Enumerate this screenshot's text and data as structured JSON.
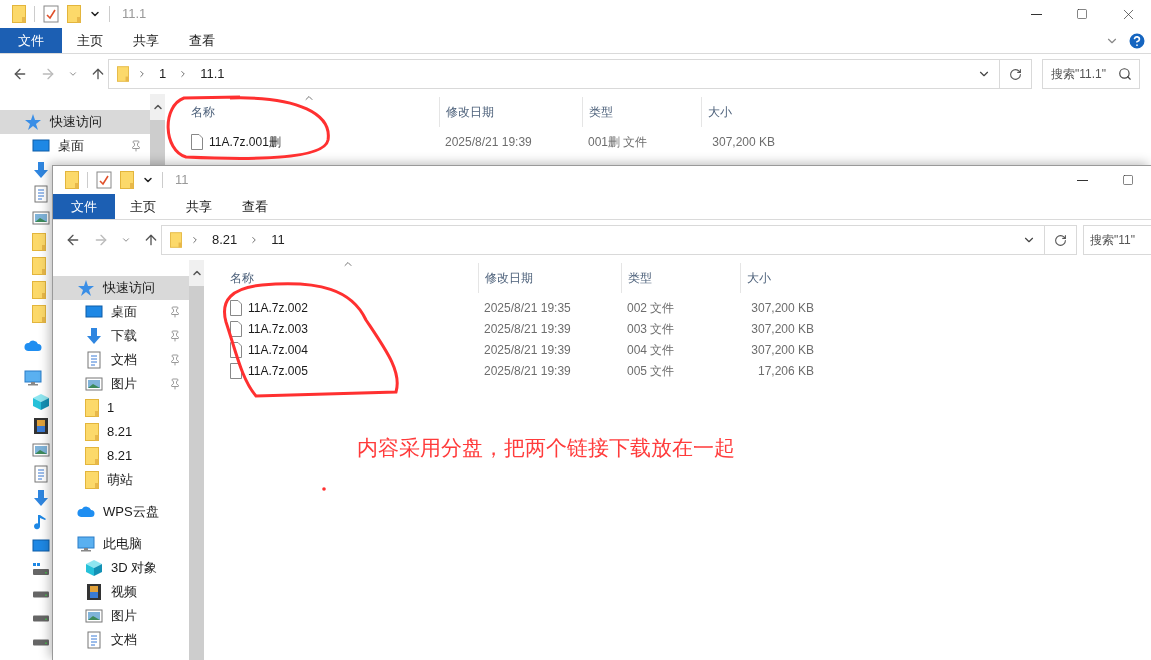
{
  "back_window": {
    "title": "11.1",
    "ribbon_tabs": [
      {
        "label": "文件",
        "kind": "menu"
      },
      {
        "label": "主页",
        "kind": "tab"
      },
      {
        "label": "共享",
        "kind": "tab"
      },
      {
        "label": "查看",
        "kind": "tab"
      }
    ],
    "breadcrumb": [
      "1",
      "11.1"
    ],
    "search": {
      "placeholder": "搜索\"11.1\""
    },
    "sidebar": [
      {
        "label": "快速访问",
        "kind": "star",
        "selected": true,
        "children": [
          {
            "label": "桌面",
            "kind": "desktop",
            "pinned": true
          },
          {
            "kind": "download"
          },
          {
            "kind": "document"
          },
          {
            "kind": "picture"
          },
          {
            "kind": "folder"
          },
          {
            "kind": "folder"
          },
          {
            "kind": "folder"
          },
          {
            "kind": "folder"
          }
        ]
      },
      {
        "kind": "cloud",
        "selected": false
      },
      {
        "kind": "pc",
        "selected": false,
        "children": [
          {
            "kind": "cube"
          },
          {
            "kind": "video"
          },
          {
            "kind": "picture"
          },
          {
            "kind": "document"
          },
          {
            "kind": "download"
          },
          {
            "kind": "music"
          },
          {
            "kind": "desktop"
          },
          {
            "kind": "drive-win"
          },
          {
            "kind": "drive"
          },
          {
            "kind": "drive"
          },
          {
            "kind": "drive"
          }
        ]
      }
    ],
    "columns": [
      "名称",
      "修改日期",
      "类型",
      "大小"
    ],
    "rows": [
      {
        "name": "11A.7z.001删",
        "date": "2025/8/21 19:39",
        "type": "001删 文件",
        "size": "307,200 KB"
      }
    ]
  },
  "front_window": {
    "title": "11",
    "ribbon_tabs": [
      {
        "label": "文件",
        "kind": "menu"
      },
      {
        "label": "主页",
        "kind": "tab"
      },
      {
        "label": "共享",
        "kind": "tab"
      },
      {
        "label": "查看",
        "kind": "tab"
      }
    ],
    "breadcrumb": [
      "8.21",
      "11"
    ],
    "search": {
      "placeholder": "搜索\"11\""
    },
    "sidebar": [
      {
        "label": "快速访问",
        "kind": "star",
        "selected": true,
        "children": [
          {
            "label": "桌面",
            "kind": "desktop",
            "pinned": true
          },
          {
            "label": "下载",
            "kind": "download",
            "pinned": true
          },
          {
            "label": "文档",
            "kind": "document",
            "pinned": true
          },
          {
            "label": "图片",
            "kind": "picture",
            "pinned": true
          },
          {
            "label": "1",
            "kind": "folder",
            "pinned": false
          },
          {
            "label": "8.21",
            "kind": "folder",
            "pinned": false
          },
          {
            "label": "8.21",
            "kind": "folder",
            "pinned": false
          },
          {
            "label": "萌站",
            "kind": "folder",
            "pinned": false
          }
        ]
      },
      {
        "label": "WPS云盘",
        "kind": "cloud",
        "selected": false
      },
      {
        "label": "此电脑",
        "kind": "pc",
        "selected": false,
        "children": [
          {
            "label": "3D 对象",
            "kind": "cube"
          },
          {
            "label": "视频",
            "kind": "video"
          },
          {
            "label": "图片",
            "kind": "picture"
          },
          {
            "label": "文档",
            "kind": "document"
          }
        ]
      }
    ],
    "columns": [
      "名称",
      "修改日期",
      "类型",
      "大小"
    ],
    "rows": [
      {
        "name": "11A.7z.002",
        "date": "2025/8/21 19:35",
        "type": "002 文件",
        "size": "307,200 KB"
      },
      {
        "name": "11A.7z.003",
        "date": "2025/8/21 19:39",
        "type": "003 文件",
        "size": "307,200 KB"
      },
      {
        "name": "11A.7z.004",
        "date": "2025/8/21 19:39",
        "type": "004 文件",
        "size": "307,200 KB"
      },
      {
        "name": "11A.7z.005",
        "date": "2025/8/21 19:39",
        "type": "005 文件",
        "size": "17,206 KB"
      }
    ]
  },
  "annotation": {
    "text": "内容采用分盘，把两个链接下载放在一起"
  }
}
